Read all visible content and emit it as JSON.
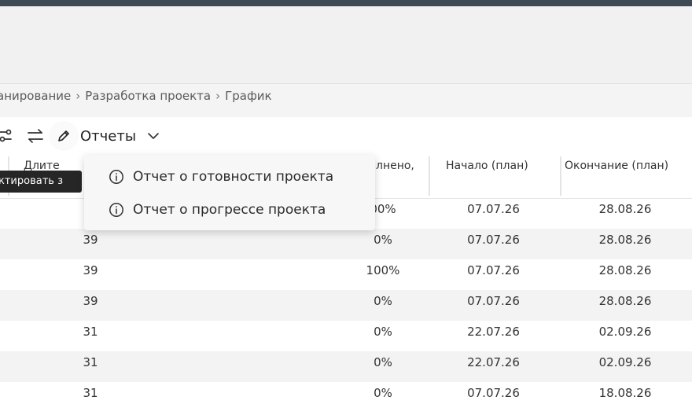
{
  "breadcrumb": [
    "анирование",
    "Разработка проекта",
    "График"
  ],
  "toolbar": {
    "reports_label": "Отчеты"
  },
  "tooltip": "ктировать з",
  "table": {
    "columns": {
      "duration": "Длите",
      "done": "лнено,",
      "start": "Начало (план)",
      "end": "Окончание (план)"
    },
    "rows": [
      {
        "duration": "",
        "done": "00%",
        "start": "07.07.26",
        "end": "28.08.26"
      },
      {
        "duration": "39",
        "done": "0%",
        "start": "07.07.26",
        "end": "28.08.26"
      },
      {
        "duration": "39",
        "done": "100%",
        "start": "07.07.26",
        "end": "28.08.26"
      },
      {
        "duration": "39",
        "done": "0%",
        "start": "07.07.26",
        "end": "28.08.26"
      },
      {
        "duration": "31",
        "done": "0%",
        "start": "22.07.26",
        "end": "02.09.26"
      },
      {
        "duration": "31",
        "done": "0%",
        "start": "22.07.26",
        "end": "02.09.26"
      },
      {
        "duration": "31",
        "done": "0%",
        "start": "07.07.26",
        "end": "18.08.26"
      }
    ]
  },
  "reports_menu": [
    {
      "icon": "info-icon",
      "label": "Отчет о готовности проекта"
    },
    {
      "icon": "info-icon",
      "label": "Отчет о прогрессе проекта"
    }
  ]
}
